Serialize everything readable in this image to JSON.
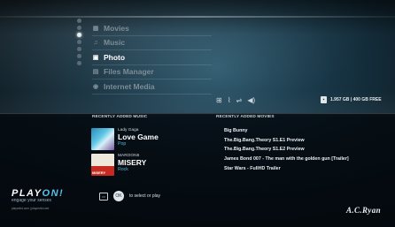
{
  "menu": {
    "items": [
      {
        "label": "Movies",
        "icon": "film-icon",
        "active": false
      },
      {
        "label": "Music",
        "icon": "music-icon",
        "active": false
      },
      {
        "label": "Photo",
        "icon": "photo-icon",
        "active": true
      },
      {
        "label": "Files Manager",
        "icon": "folder-icon",
        "active": false
      },
      {
        "label": "Internet Media",
        "icon": "globe-icon",
        "active": false
      }
    ],
    "dots": [
      false,
      false,
      true,
      false,
      false,
      false,
      false
    ]
  },
  "status": {
    "icons": [
      "network-icon",
      "wifi-icon",
      "usb-icon",
      "volume-icon"
    ],
    "storage": "1.957 GB | 400 GB FREE"
  },
  "recent_music": {
    "title": "RECENTLY ADDED MUSIC",
    "items": [
      {
        "artist": "Lady Gaga",
        "title": "Love Game",
        "genre": "Pop"
      },
      {
        "artist": "MAROON5",
        "title": "MISERY",
        "genre": "Rock",
        "cover_text": "MISERY"
      }
    ]
  },
  "recent_movies": {
    "title": "RECENTLY ADDED MOVIES",
    "items": [
      "Big Bunny",
      "The.Big.Bang.Theory S1.E1 Preview",
      "The.Big.Bang.Theory S1.E2 Preview",
      "James Bond 007 - The man with the golden gun [Trailer]",
      "Star Wars - FullHD Trailer"
    ]
  },
  "footer": {
    "brand_play": "PLAY",
    "brand_on": "ON!",
    "tagline": "engage your senses",
    "links": "playonhd.com | playonhd.com",
    "hint_key": "OK",
    "hint_text": "to select or play",
    "brand_right": "A.C.Ryan"
  },
  "colors": {
    "accent": "#4fb6d9",
    "menu_inactive": "#7d8d97",
    "menu_active": "#ffffff"
  }
}
